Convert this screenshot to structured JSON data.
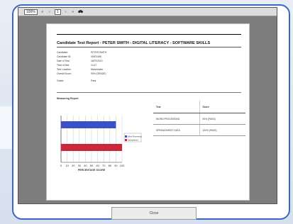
{
  "toolbar": {
    "zoom": "100%",
    "page_indicator": "1",
    "nav_first": "«",
    "nav_prev": "‹",
    "nav_next": "›",
    "nav_last": "»",
    "icon": "binoculars-icon"
  },
  "report": {
    "title": "Candidate Test Report - PETER SMITH - DIGITAL LITERACY - SOFTWARE SKILLS",
    "fields": [
      {
        "label": "Candidate:",
        "value": "PETER SMITH"
      },
      {
        "label": "Candidate ID:",
        "value": "00001456"
      },
      {
        "label": "Date of Test:",
        "value": "18/07/2013"
      },
      {
        "label": "Time of test:",
        "value": "14:17"
      },
      {
        "label": "Test Location:",
        "value": "Manchester"
      },
      {
        "label": "Overall Score:",
        "value": "90% (GRADE)"
      },
      {
        "label": "Grade:",
        "value": "Pass"
      }
    ],
    "section_heading": "Measuring Report",
    "table_headers": [
      "Test",
      "Score"
    ],
    "table_rows": [
      [
        "WORD PROCESSING",
        "90% (PASS)"
      ],
      [
        "SPREADSHEET DATA",
        "100% (PASS)"
      ]
    ]
  },
  "chart_data": {
    "type": "bar",
    "orientation": "horizontal",
    "categories": [
      "Word Processing",
      "Spreadsheet"
    ],
    "series": [
      {
        "name": "Word Processing",
        "values": [
          90
        ],
        "color": "#3a4fc8"
      },
      {
        "name": "Spreadsheet",
        "values": [
          100
        ],
        "color": "#c8283a"
      }
    ],
    "xlabel": "PERCENTAGE SCORE",
    "xticks": [
      0,
      10,
      20,
      30,
      40,
      50,
      60,
      70,
      80,
      90,
      100
    ],
    "xlim": [
      0,
      100
    ]
  },
  "footer": {
    "close_label": "Close"
  }
}
